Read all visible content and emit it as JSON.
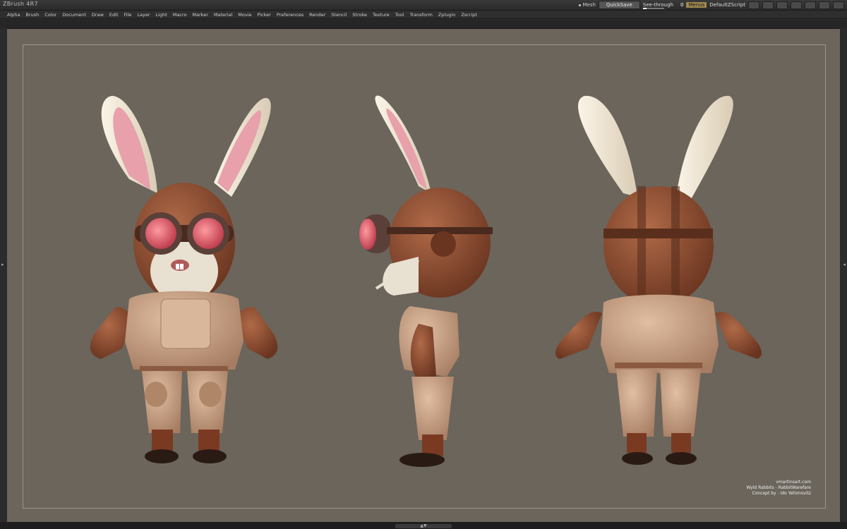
{
  "app": {
    "title": "ZBrush 4R7"
  },
  "toolbar": {
    "mesh_label": "Mesh",
    "quicksave": "QuickSave",
    "see_through": "See-through",
    "see_through_value": "0",
    "menus": "Menus",
    "script": "DefaultZScript"
  },
  "menubar": [
    "Alpha",
    "Brush",
    "Color",
    "Document",
    "Draw",
    "Edit",
    "File",
    "Layer",
    "Light",
    "Macro",
    "Marker",
    "Material",
    "Movie",
    "Picker",
    "Preferences",
    "Render",
    "Stencil",
    "Stroke",
    "Texture",
    "Tool",
    "Transform",
    "Zplugin",
    "Zscript"
  ],
  "credits": {
    "site": "vmartinsart.com",
    "project": "Wyld Rabbits - RabbitWarefare",
    "concept": "Concept by - Ido Yehimovitz"
  },
  "colors": {
    "canvas": "#6b655c",
    "leather": "#8a4a30",
    "suit": "#c9a184",
    "ears": "#ece3d2",
    "goggle": "#e0707a"
  }
}
